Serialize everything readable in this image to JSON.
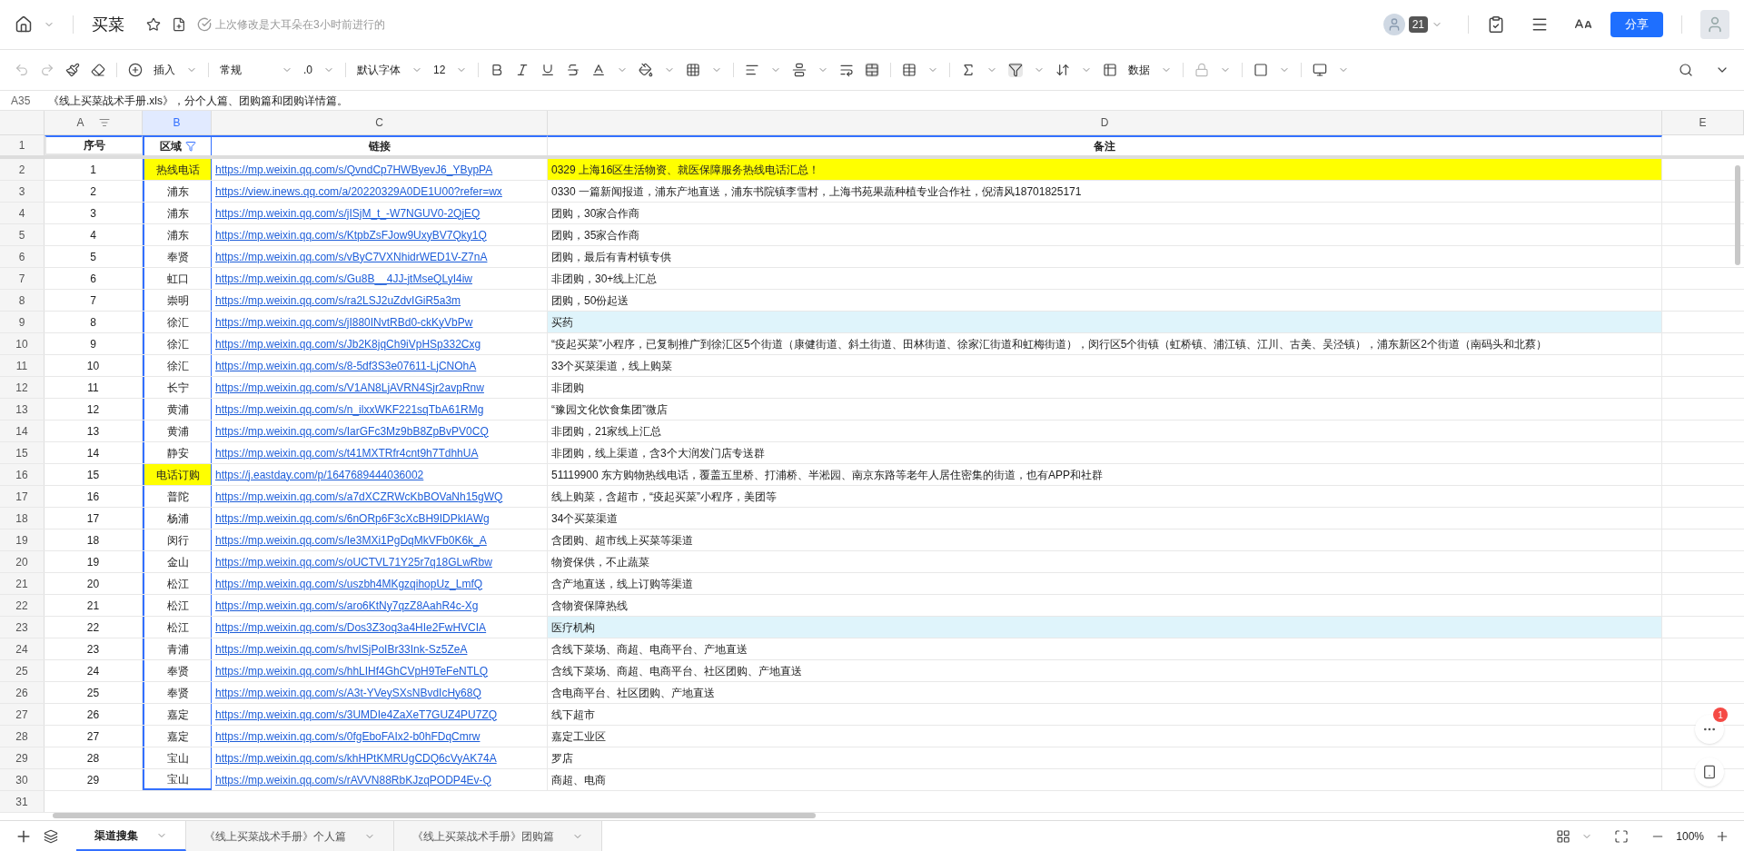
{
  "doc": {
    "title": "买菜",
    "last_edit": "上次修改是大耳朵在3小时前进行的",
    "collaborator_count": "21",
    "share": "分享"
  },
  "toolbar": {
    "insert": "插入",
    "number_format": "常规",
    "decimal": ".0",
    "font": "默认字体",
    "font_size": "12",
    "data": "数据"
  },
  "formula_bar": {
    "cell_ref": "A35",
    "content": "《线上买菜战术手册.xls》，分个人篇、团购篇和团购详情篇。"
  },
  "columns": [
    {
      "label": "A",
      "selected": false
    },
    {
      "label": "B",
      "selected": true
    },
    {
      "label": "C",
      "selected": false
    },
    {
      "label": "D",
      "selected": false
    },
    {
      "label": "E",
      "selected": false
    }
  ],
  "header_row": {
    "row_number": "1",
    "cells": [
      "序号",
      "区域",
      "链接",
      "备注"
    ]
  },
  "rows": [
    {
      "kind": "highlight",
      "row_number": "2",
      "index": "1",
      "area": "热线电话",
      "area_highlighted": true,
      "link": "https://mp.weixin.qq.com/s/QvndCp7HWByevJ6_YBypPA",
      "note": "0329 上海16区生活物资、就医保障服务热线电话汇总！"
    },
    {
      "kind": "normal",
      "row_number": "3",
      "index": "2",
      "area": "浦东",
      "area_highlighted": false,
      "link": "https://view.inews.qq.com/a/20220329A0DE1U00?refer=wx",
      "note": "0330 一篇新闻报道，浦东产地直送，浦东书院镇李雪村，上海书苑果蔬种植专业合作社，倪清风18701825171"
    },
    {
      "kind": "normal",
      "row_number": "4",
      "index": "3",
      "area": "浦东",
      "area_highlighted": false,
      "link": "https://mp.weixin.qq.com/s/jISjM_t_-W7NGUV0-2QjEQ",
      "note": "团购，30家合作商"
    },
    {
      "kind": "normal",
      "row_number": "5",
      "index": "4",
      "area": "浦东",
      "area_highlighted": false,
      "link": "https://mp.weixin.qq.com/s/KtpbZsFJow9UxyBV7Qky1Q",
      "note": "团购，35家合作商"
    },
    {
      "kind": "normal",
      "row_number": "6",
      "index": "5",
      "area": "奉贤",
      "area_highlighted": false,
      "link": "https://mp.weixin.qq.com/s/vByC7VXNhidrWED1V-Z7nA",
      "note": "团购，最后有青村镇专供"
    },
    {
      "kind": "normal",
      "row_number": "7",
      "index": "6",
      "area": "虹口",
      "area_highlighted": false,
      "link": "https://mp.weixin.qq.com/s/Gu8B__4JJ-jtMseQLyI4iw",
      "note": "非团购，30+线上汇总"
    },
    {
      "kind": "normal",
      "row_number": "8",
      "index": "7",
      "area": "崇明",
      "area_highlighted": false,
      "link": "https://mp.weixin.qq.com/s/ra2LSJ2uZdvIGiR5a3m",
      "note": "团购，50份起送"
    },
    {
      "kind": "info",
      "row_number": "9",
      "index": "8",
      "area": "徐汇",
      "area_highlighted": false,
      "link": "https://mp.weixin.qq.com/s/jI880INvtRBd0-ckKyVbPw",
      "note": "买药"
    },
    {
      "kind": "normal",
      "row_number": "10",
      "index": "9",
      "area": "徐汇",
      "area_highlighted": false,
      "link": "https://mp.weixin.qq.com/s/Jb2K8jqCh9iVpHSp332Cxg",
      "note": "“疫起买菜”小程序，已复制推广到徐汇区5个街道（康健街道、斜土街道、田林街道、徐家汇街道和虹梅街道），闵行区5个街镇（虹桥镇、浦江镇、江川、古美、吴泾镇），浦东新区2个街道（南码头和北蔡）"
    },
    {
      "kind": "normal",
      "row_number": "11",
      "index": "10",
      "area": "徐汇",
      "area_highlighted": false,
      "link": "https://mp.weixin.qq.com/s/8-5df3S3e07611-LjCNOhA",
      "note": "33个买菜渠道，线上购菜"
    },
    {
      "kind": "normal",
      "row_number": "12",
      "index": "11",
      "area": "长宁",
      "area_highlighted": false,
      "link": "https://mp.weixin.qq.com/s/V1AN8LjAVRN4Sjr2avpRnw",
      "note": "非团购"
    },
    {
      "kind": "normal",
      "row_number": "13",
      "index": "12",
      "area": "黄浦",
      "area_highlighted": false,
      "link": "https://mp.weixin.qq.com/s/n_ilxxWKF221sqTbA61RMg",
      "note": "“豫园文化饮食集团”微店"
    },
    {
      "kind": "normal",
      "row_number": "14",
      "index": "13",
      "area": "黄浦",
      "area_highlighted": false,
      "link": "https://mp.weixin.qq.com/s/IarGFc3Mz9bB8ZpBvPV0CQ",
      "note": "非团购，21家线上汇总"
    },
    {
      "kind": "normal",
      "row_number": "15",
      "index": "14",
      "area": "静安",
      "area_highlighted": false,
      "link": "https://mp.weixin.qq.com/s/t41MXTRfr4cnt9h7TdhhUA",
      "note": "非团购，线上渠道，含3个大润发门店专送群"
    },
    {
      "kind": "normal",
      "row_number": "16",
      "index": "15",
      "area": "电话订购",
      "area_highlighted": true,
      "link": "https://j.eastday.com/p/1647689444036002",
      "note": "51119900 东方购物热线电话，覆盖五里桥、打浦桥、半淞园、南京东路等老年人居住密集的街道，也有APP和社群"
    },
    {
      "kind": "normal",
      "row_number": "17",
      "index": "16",
      "area": "普陀",
      "area_highlighted": false,
      "link": "https://mp.weixin.qq.com/s/a7dXCZRWcKbBOVaNh15gWQ",
      "note": "线上购菜，含超市，“疫起买菜”小程序，美团等"
    },
    {
      "kind": "normal",
      "row_number": "18",
      "index": "17",
      "area": "杨浦",
      "area_highlighted": false,
      "link": "https://mp.weixin.qq.com/s/6nORp6F3cXcBH9IDPkIAWg",
      "note": "34个买菜渠道"
    },
    {
      "kind": "normal",
      "row_number": "19",
      "index": "18",
      "area": "闵行",
      "area_highlighted": false,
      "link": "https://mp.weixin.qq.com/s/Ie3MXi1PgDqMkVFb0K6k_A",
      "note": "含团购、超市线上买菜等渠道"
    },
    {
      "kind": "normal",
      "row_number": "20",
      "index": "19",
      "area": "金山",
      "area_highlighted": false,
      "link": "https://mp.weixin.qq.com/s/oUCTVL71Y25r7q18GLwRbw",
      "note": "物资保供，不止蔬菜"
    },
    {
      "kind": "normal",
      "row_number": "21",
      "index": "20",
      "area": "松江",
      "area_highlighted": false,
      "link": "https://mp.weixin.qq.com/s/uszbh4MKgzqihopUz_LmfQ",
      "note": "含产地直送，线上订购等渠道"
    },
    {
      "kind": "normal",
      "row_number": "22",
      "index": "21",
      "area": "松江",
      "area_highlighted": false,
      "link": "https://mp.weixin.qq.com/s/aro6KtNy7qzZ8AahR4c-Xg",
      "note": "含物资保障热线"
    },
    {
      "kind": "info",
      "row_number": "23",
      "index": "22",
      "area": "松江",
      "area_highlighted": false,
      "link": "https://mp.weixin.qq.com/s/Dos3Z3oq3a4HIe2FwHVCIA",
      "note": "医疗机构"
    },
    {
      "kind": "normal",
      "row_number": "24",
      "index": "23",
      "area": "青浦",
      "area_highlighted": false,
      "link": "https://mp.weixin.qq.com/s/hvISjPoIBr33Ink-Sz5ZeA",
      "note": "含线下菜场、商超、电商平台、产地直送"
    },
    {
      "kind": "normal",
      "row_number": "25",
      "index": "24",
      "area": "奉贤",
      "area_highlighted": false,
      "link": "https://mp.weixin.qq.com/s/hhLIHf4GhCVpH9TeFeNTLQ",
      "note": "含线下菜场、商超、电商平台、社区团购、产地直送"
    },
    {
      "kind": "normal",
      "row_number": "26",
      "index": "25",
      "area": "奉贤",
      "area_highlighted": false,
      "link": "https://mp.weixin.qq.com/s/A3t-YVeySXsNBvdIcHy68Q",
      "note": "含电商平台、社区团购、产地直送"
    },
    {
      "kind": "normal",
      "row_number": "27",
      "index": "26",
      "area": "嘉定",
      "area_highlighted": false,
      "link": "https://mp.weixin.qq.com/s/3UMDIe4ZaXeT7GUZ4PU7ZQ",
      "note": "线下超市"
    },
    {
      "kind": "normal",
      "row_number": "28",
      "index": "27",
      "area": "嘉定",
      "area_highlighted": false,
      "link": "https://mp.weixin.qq.com/s/0fgEboFAIx2-b0hFDqCmrw",
      "note": "嘉定工业区"
    },
    {
      "kind": "normal",
      "row_number": "29",
      "index": "28",
      "area": "宝山",
      "area_highlighted": false,
      "link": "https://mp.weixin.qq.com/s/khHPtKMRUgCDQ6cVyAK74A",
      "note": "罗店"
    },
    {
      "kind": "normal",
      "row_number": "30",
      "index": "29",
      "area": "宝山",
      "area_highlighted": false,
      "link": "https://mp.weixin.qq.com/s/rAVVN88RbKJzqPODP4Ev-Q",
      "note": "商超、电商"
    }
  ],
  "empty_row": {
    "row_number": "31"
  },
  "sheet_tabs": [
    {
      "label": "渠道搜集",
      "selected": true
    },
    {
      "label": "《线上买菜战术手册》个人篇",
      "selected": false
    },
    {
      "label": "《线上买菜战术手册》团购篇",
      "selected": false
    }
  ],
  "zoom": "100%",
  "notification_count": "1"
}
